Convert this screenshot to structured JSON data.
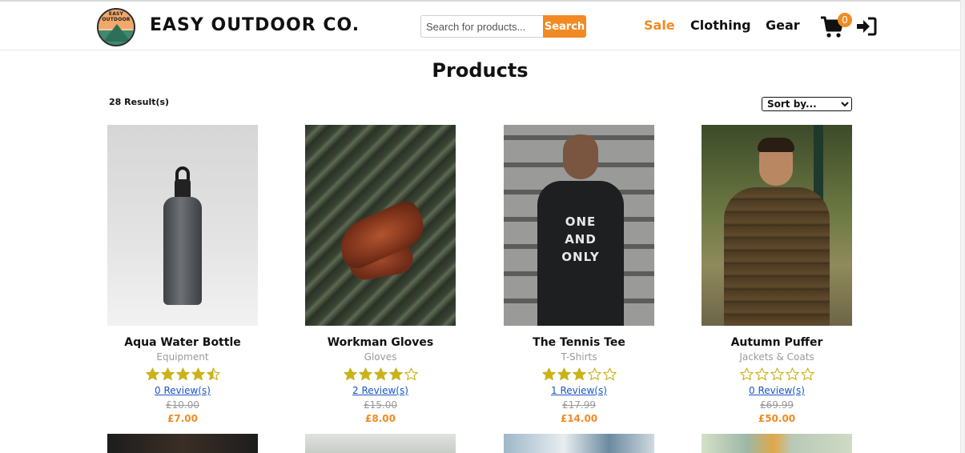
{
  "header": {
    "logo_text": "EASY OUTDOOR",
    "brand": "EASY OUTDOOR CO.",
    "search": {
      "placeholder": "Search for products...",
      "button": "Search"
    },
    "nav": [
      {
        "label": "Sale",
        "color": "#f28a24"
      },
      {
        "label": "Clothing"
      },
      {
        "label": "Gear"
      }
    ],
    "cart_count": "0",
    "icons": {
      "cart": "shopping-cart-icon",
      "login": "sign-in-icon"
    }
  },
  "page": {
    "title": "Products",
    "results": "28 Result(s)",
    "sort": {
      "selected": "Sort by..."
    }
  },
  "products": [
    {
      "name": "Aqua Water Bottle",
      "category": "Equipment",
      "rating": 4.5,
      "reviews": "0 Review(s)",
      "was": "£10.00",
      "now": "£7.00"
    },
    {
      "name": "Workman Gloves",
      "category": "Gloves",
      "rating": 4,
      "reviews": "2 Review(s)",
      "was": "£15.00",
      "now": "£8.00"
    },
    {
      "name": "The Tennis Tee",
      "category": "T-Shirts",
      "rating": 3,
      "reviews": "1 Review(s)",
      "was": "£17.99",
      "now": "£14.00"
    },
    {
      "name": "Autumn Puffer",
      "category": "Jackets & Coats",
      "rating": 0,
      "reviews": "0 Review(s)",
      "was": "£69.99",
      "now": "£50.00"
    }
  ],
  "tee_print": [
    "ONE",
    "AND",
    "ONLY"
  ],
  "colors": {
    "accent": "#f28a24",
    "star": "#c9b31a",
    "link": "#1a55c9"
  }
}
